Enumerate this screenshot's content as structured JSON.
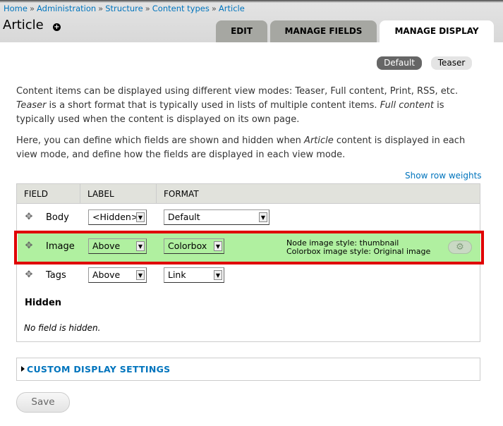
{
  "breadcrumb": [
    "Home",
    "Administration",
    "Structure",
    "Content types",
    "Article"
  ],
  "breadcrumb_sep": "»",
  "page_title": "Article",
  "shortcut_symbol": "+",
  "tabs": [
    {
      "label": "Edit",
      "active": false
    },
    {
      "label": "Manage fields",
      "active": false
    },
    {
      "label": "Manage display",
      "active": true
    }
  ],
  "view_modes": [
    {
      "label": "Default",
      "active": true
    },
    {
      "label": "Teaser",
      "active": false
    }
  ],
  "description": {
    "p1_part1": "Content items can be displayed using different view modes: Teaser, Full content, Print, RSS, etc. ",
    "p1_em1": "Teaser",
    "p1_part2": " is a short format that is typically used in lists of multiple content items. ",
    "p1_em2": "Full content",
    "p1_part3": " is typically used when the content is displayed on its own page.",
    "p2_part1": "Here, you can define which fields are shown and hidden when ",
    "p2_em": "Article",
    "p2_part2": " content is displayed in each view mode, and define how the fields are displayed in each view mode."
  },
  "show_row_weights": "Show row weights",
  "table": {
    "headers": [
      "Field",
      "Label",
      "Format"
    ],
    "rows": [
      {
        "field": "Body",
        "label": "<Hidden>",
        "format": "Default"
      },
      {
        "field": "Image",
        "label": "Above",
        "format": "Colorbox",
        "summary": [
          "Node image style: thumbnail",
          "Colorbox image style: Original image"
        ]
      },
      {
        "field": "Tags",
        "label": "Above",
        "format": "Link"
      }
    ],
    "hidden_region": "Hidden",
    "hidden_empty": "No field is hidden."
  },
  "custom_display_settings": "Custom display settings",
  "save_label": "Save",
  "colors": {
    "link": "#0074bd",
    "highlight_row": "#b0f0a0",
    "highlight_frame": "#e00000"
  }
}
